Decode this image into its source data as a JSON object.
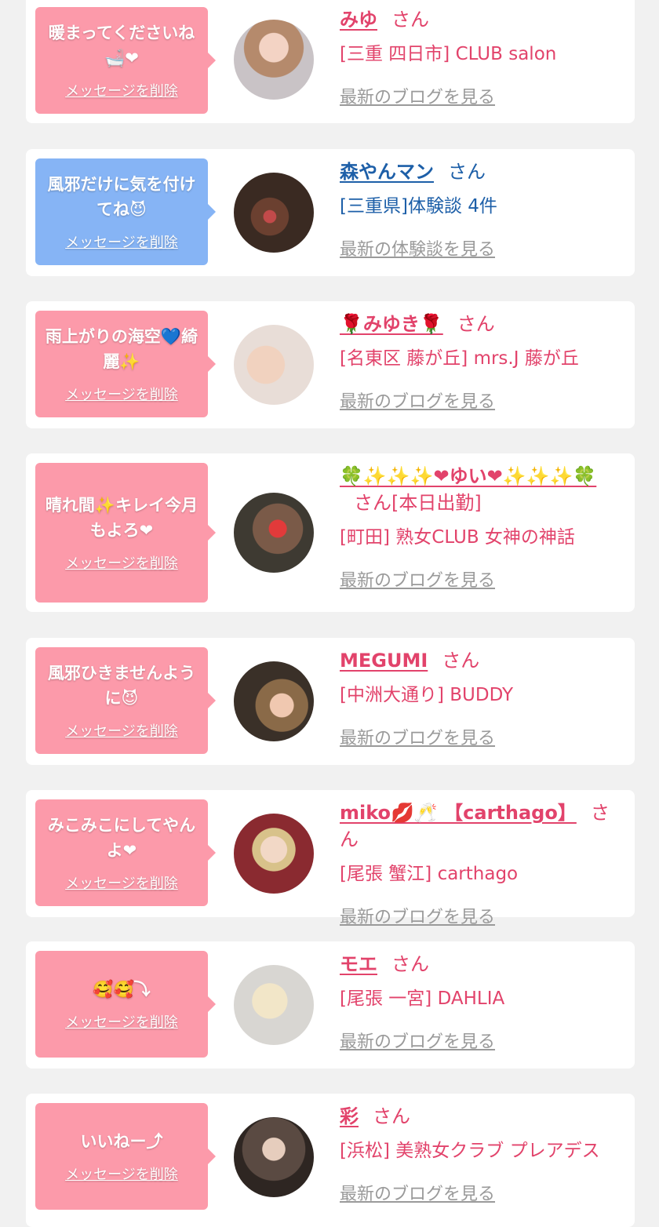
{
  "delete_label": "メッセージを削除",
  "san": "さん",
  "items": [
    {
      "message": "暖まってくださいね🛁❤",
      "name": "みゆ",
      "san": "さん",
      "shop": "[三重 四日市] CLUB salon",
      "more": "最新のブログを見る"
    },
    {
      "message": "風邪だけに気を付けてね😈",
      "name": "森やんマン",
      "san": "さん",
      "shop": "[三重県]体験談 4件",
      "more": "最新の体験談を見る"
    },
    {
      "message": "雨上がりの海空💙綺麗✨",
      "name": "🌹みゆき🌹",
      "san": "さん",
      "shop": "[名東区 藤が丘] mrs.J 藤が丘",
      "more": "最新のブログを見る"
    },
    {
      "message": "晴れ間✨キレイ今月もよろ❤",
      "name": "🍀✨✨✨❤ゆい❤✨✨✨🍀",
      "san": "さん[本日出勤]",
      "shop": "[町田] 熟女CLUB 女神の神話",
      "more": "最新のブログを見る"
    },
    {
      "message": "風邪ひきませんように😈",
      "name": "MEGUMI",
      "san": "さん",
      "shop": "[中洲大通り] BUDDY",
      "more": "最新のブログを見る"
    },
    {
      "message": "みこみこにしてやんよ❤",
      "name": "miko💋🥂 【carthago】",
      "san": "さん",
      "shop": "[尾張 蟹江] carthago",
      "more": "最新のブログを見る"
    },
    {
      "message": "🥰🥰⤵",
      "name": "モエ",
      "san": "さん",
      "shop": "[尾張 一宮] DAHLIA",
      "more": "最新のブログを見る"
    },
    {
      "message": "いいねー⤴",
      "name": "彩",
      "san": "さん",
      "shop": "[浜松] 美熟女クラブ プレアデス",
      "more": "最新のブログを見る"
    }
  ]
}
